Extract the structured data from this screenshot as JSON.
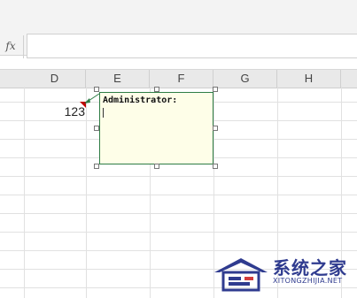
{
  "formula_bar": {
    "fx_label": "fx",
    "value": ""
  },
  "columns": [
    "D",
    "E",
    "F",
    "G",
    "H"
  ],
  "cell": {
    "ref": "D2",
    "value": "123"
  },
  "comment": {
    "author": "Administrator:",
    "text": ""
  },
  "watermark": {
    "title": "系统之家",
    "subtitle": "XITONGZHIJIA.NET"
  },
  "colors": {
    "comment_bg": "#fefee8",
    "comment_border": "#2e7d45",
    "indicator": "#c00000",
    "watermark": "#2f3b8f"
  }
}
